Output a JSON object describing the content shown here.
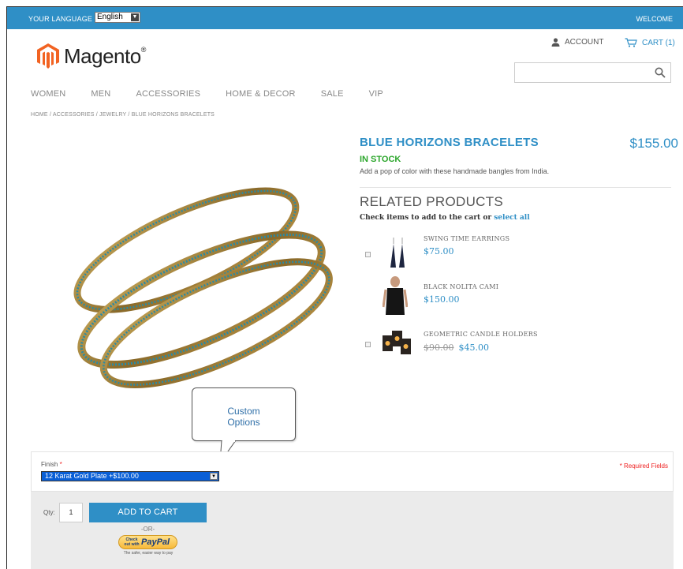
{
  "topbar": {
    "language_label": "YOUR LANGUAGE",
    "language_value": "English",
    "welcome": "WELCOME"
  },
  "header": {
    "logo_text": "Magento",
    "logo_mark": "®",
    "account_label": "ACCOUNT",
    "cart_label": "CART (1)",
    "search_placeholder": ""
  },
  "nav": {
    "items": [
      {
        "label": "WOMEN"
      },
      {
        "label": "MEN"
      },
      {
        "label": "ACCESSORIES"
      },
      {
        "label": "HOME & DECOR"
      },
      {
        "label": "SALE"
      },
      {
        "label": "VIP"
      }
    ]
  },
  "breadcrumb": "HOME / ACCESSORIES / JEWELRY / BLUE HORIZONS BRACELETS",
  "product": {
    "title": "BLUE HORIZONS BRACELETS",
    "price": "$155.00",
    "stock": "IN STOCK",
    "description": "Add a pop of color with these handmade bangles from India."
  },
  "related": {
    "title": "RELATED PRODUCTS",
    "subtitle_prefix": "Check items to add to the cart or",
    "select_all": "select all",
    "items": [
      {
        "name": "SWING TIME EARRINGS",
        "price": "$75.00",
        "old_price": "",
        "icon": "earrings-thumbnail"
      },
      {
        "name": "BLACK NOLITA CAMI",
        "price": "$150.00",
        "old_price": "",
        "icon": "cami-thumbnail"
      },
      {
        "name": "GEOMETRIC CANDLE HOLDERS",
        "price": "$45.00",
        "old_price": "$90.00",
        "icon": "candle-holders-thumbnail"
      }
    ]
  },
  "callout": {
    "line1": "Custom",
    "line2": "Options"
  },
  "options": {
    "finish_label": "Finish",
    "required_star": "*",
    "finish_value": "12 Karat Gold Plate +$100.00",
    "required_note": "* Required Fields"
  },
  "purchase": {
    "qty_label": "Qty:",
    "qty_value": "1",
    "add_to_cart": "ADD TO CART",
    "or": "-OR-",
    "paypal_checkout": "Check out with",
    "paypal_brand": "PayPal",
    "paypal_tagline": "The safer, easier way to pay"
  },
  "colors": {
    "accent": "#2f8fc6",
    "in_stock": "#2aa52a",
    "required": "#e22222",
    "logo_orange": "#f26322"
  }
}
